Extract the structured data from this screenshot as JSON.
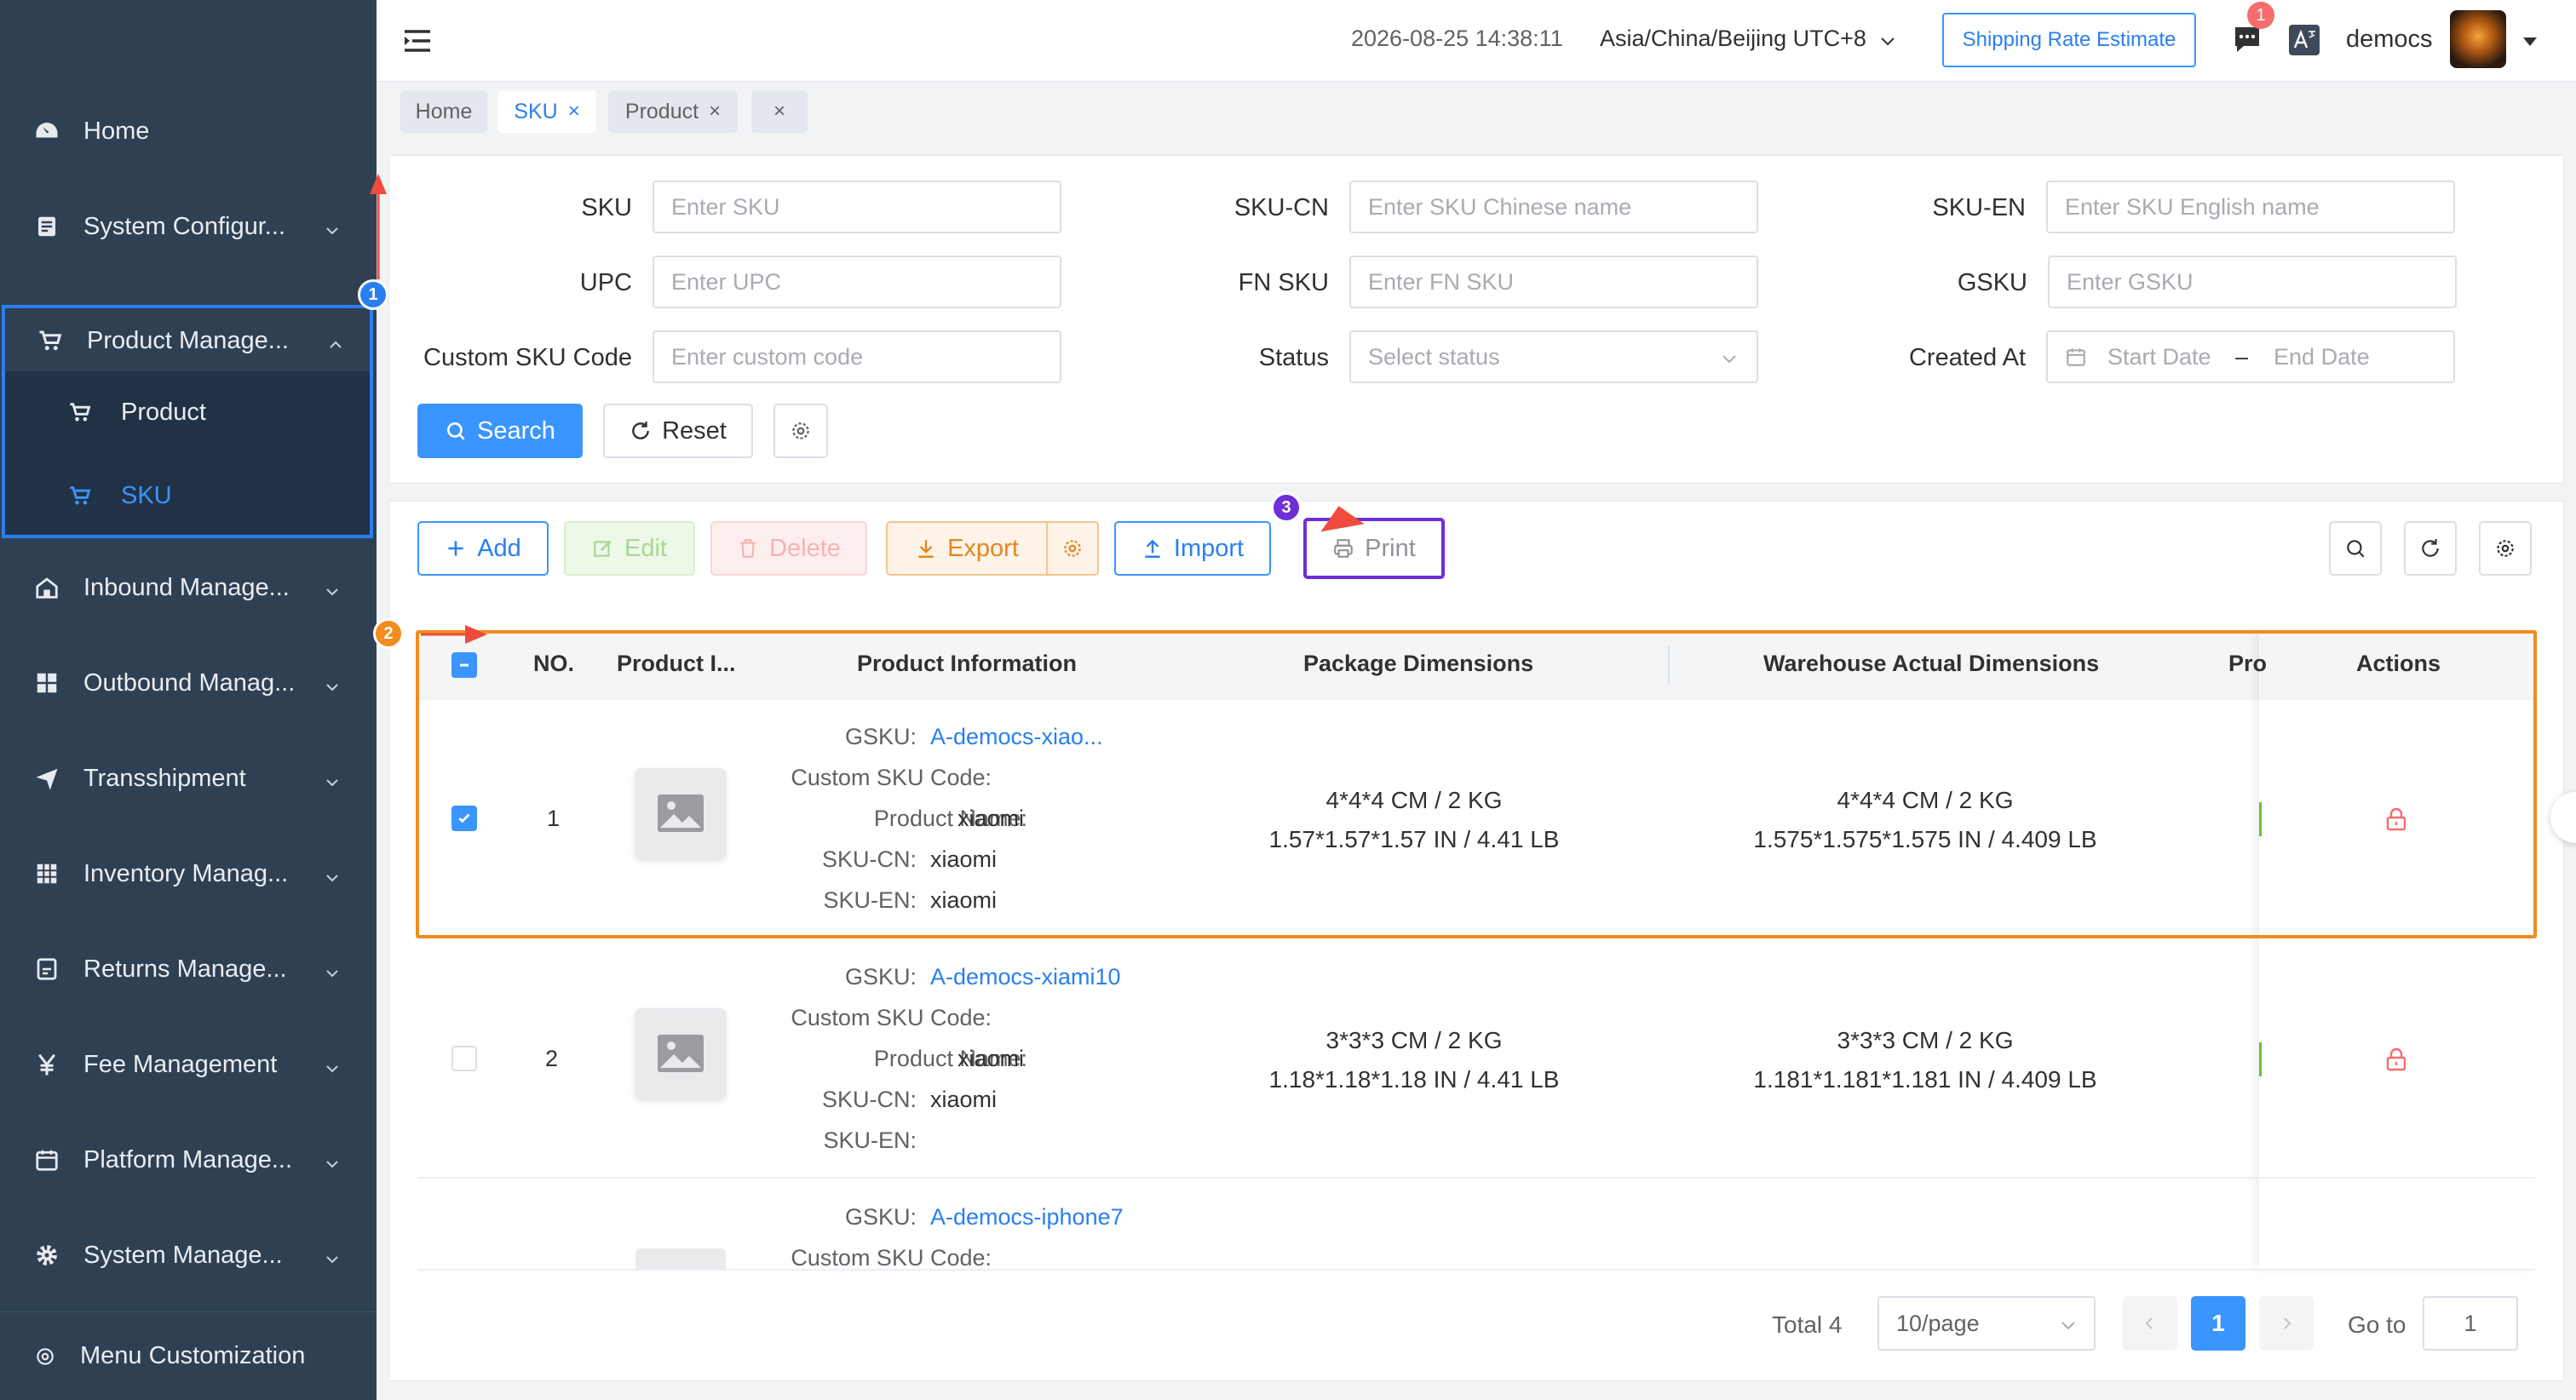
{
  "sidebar": {
    "items": [
      {
        "label": "Home",
        "icon": "dashboard-icon"
      },
      {
        "label": "System Configur...",
        "icon": "document-icon"
      },
      {
        "label": "Product Manage...",
        "icon": "cart-icon"
      },
      {
        "label": "Inbound Manage...",
        "icon": "house-icon"
      },
      {
        "label": "Outbound Manag...",
        "icon": "grid-icon"
      },
      {
        "label": "Transshipment",
        "icon": "send-icon"
      },
      {
        "label": "Inventory Manag...",
        "icon": "table-icon"
      },
      {
        "label": "Returns Manage...",
        "icon": "return-icon"
      },
      {
        "label": "Fee Management",
        "icon": "yen-icon"
      },
      {
        "label": "Platform Manage...",
        "icon": "calendar-icon"
      },
      {
        "label": "System Manage...",
        "icon": "gear-icon"
      }
    ],
    "subitems": [
      {
        "label": "Product"
      },
      {
        "label": "SKU"
      }
    ],
    "menu_customization": "Menu Customization"
  },
  "header": {
    "datetime": "2026-08-25 14:38:11",
    "timezone": "Asia/China/Beijing UTC+8",
    "shipping_button": "Shipping Rate Estimate",
    "notification_count": "1",
    "username": "democs"
  },
  "tabs": [
    {
      "label": "Home"
    },
    {
      "label": "SKU"
    },
    {
      "label": "Product"
    }
  ],
  "filters": {
    "sku": {
      "label": "SKU",
      "placeholder": "Enter SKU"
    },
    "sku_cn": {
      "label": "SKU-CN",
      "placeholder": "Enter SKU Chinese name"
    },
    "sku_en": {
      "label": "SKU-EN",
      "placeholder": "Enter SKU English name"
    },
    "upc": {
      "label": "UPC",
      "placeholder": "Enter UPC"
    },
    "fn_sku": {
      "label": "FN SKU",
      "placeholder": "Enter FN SKU"
    },
    "gsku": {
      "label": "GSKU",
      "placeholder": "Enter GSKU"
    },
    "custom_code": {
      "label": "Custom SKU Code",
      "placeholder": "Enter custom code"
    },
    "status": {
      "label": "Status",
      "placeholder": "Select status"
    },
    "created_at": {
      "label": "Created At",
      "start": "Start Date",
      "sep": "–",
      "end": "End Date"
    },
    "search_button": "Search",
    "reset_button": "Reset"
  },
  "toolbar": {
    "add": "Add",
    "edit": "Edit",
    "delete": "Delete",
    "export": "Export",
    "import": "Import",
    "print": "Print"
  },
  "table": {
    "headers": {
      "no": "NO.",
      "product_image": "Product I...",
      "product_info": "Product Information",
      "package_dims": "Package Dimensions",
      "warehouse_dims": "Warehouse Actual Dimensions",
      "pro": "Pro",
      "actions": "Actions"
    },
    "info_keys": {
      "gsku": "GSKU:",
      "custom_code": "Custom SKU Code:",
      "product_name": "Product Name:",
      "sku_cn": "SKU-CN:",
      "sku_en": "SKU-EN:"
    },
    "rows": [
      {
        "no": "1",
        "checked": true,
        "gsku": "A-democs-xiao...",
        "custom_code": "",
        "product_name": "xiaomi",
        "sku_cn": "xiaomi",
        "sku_en": "xiaomi",
        "package_metric": "4*4*4 CM / 2 KG",
        "package_imperial": "1.57*1.57*1.57 IN / 4.41 LB",
        "warehouse_metric": "4*4*4 CM / 2 KG",
        "warehouse_imperial": "1.575*1.575*1.575 IN / 4.409 LB"
      },
      {
        "no": "2",
        "checked": false,
        "gsku": "A-democs-xiami10",
        "custom_code": "",
        "product_name": "xiaomi",
        "sku_cn": "xiaomi",
        "sku_en": "",
        "package_metric": "3*3*3 CM / 2 KG",
        "package_imperial": "1.18*1.18*1.18 IN / 4.41 LB",
        "warehouse_metric": "3*3*3 CM / 2 KG",
        "warehouse_imperial": "1.181*1.181*1.181 IN / 4.409 LB"
      },
      {
        "no": "",
        "checked": false,
        "gsku": "A-democs-iphone7",
        "custom_code": ""
      }
    ]
  },
  "pagination": {
    "total": "Total 4",
    "page_size": "10/page",
    "current_page": "1",
    "goto_label": "Go to",
    "goto_value": "1"
  },
  "annotations": [
    "1",
    "2",
    "3"
  ],
  "colors": {
    "sidebar_bg": "#2f4053",
    "primary": "#3a95ff",
    "annotation_blue": "#2a7ff0",
    "annotation_orange": "#f28c1c",
    "annotation_purple": "#6e2fd6",
    "arrow_red": "#ef4b3f"
  }
}
